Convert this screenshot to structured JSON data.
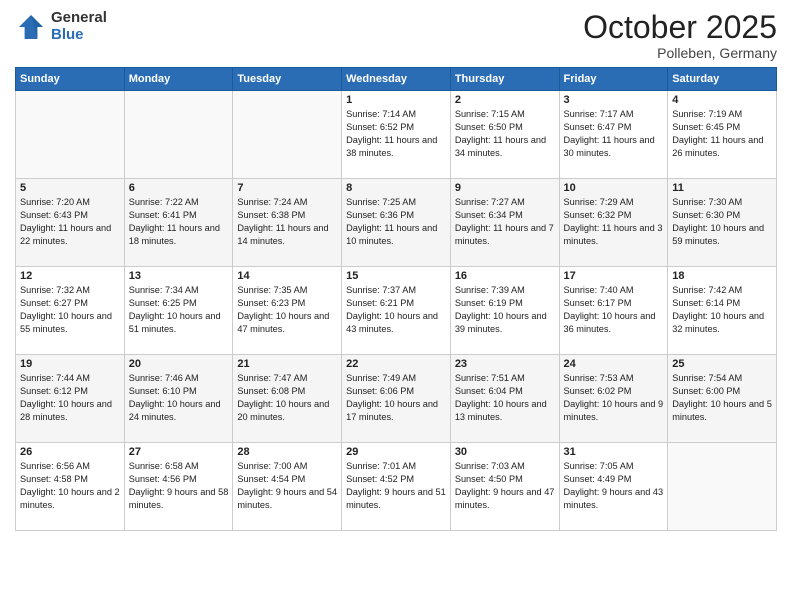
{
  "logo": {
    "general": "General",
    "blue": "Blue"
  },
  "title": "October 2025",
  "subtitle": "Polleben, Germany",
  "days_header": [
    "Sunday",
    "Monday",
    "Tuesday",
    "Wednesday",
    "Thursday",
    "Friday",
    "Saturday"
  ],
  "weeks": [
    [
      {
        "day": "",
        "sunrise": "",
        "sunset": "",
        "daylight": ""
      },
      {
        "day": "",
        "sunrise": "",
        "sunset": "",
        "daylight": ""
      },
      {
        "day": "",
        "sunrise": "",
        "sunset": "",
        "daylight": ""
      },
      {
        "day": "1",
        "sunrise": "Sunrise: 7:14 AM",
        "sunset": "Sunset: 6:52 PM",
        "daylight": "Daylight: 11 hours and 38 minutes."
      },
      {
        "day": "2",
        "sunrise": "Sunrise: 7:15 AM",
        "sunset": "Sunset: 6:50 PM",
        "daylight": "Daylight: 11 hours and 34 minutes."
      },
      {
        "day": "3",
        "sunrise": "Sunrise: 7:17 AM",
        "sunset": "Sunset: 6:47 PM",
        "daylight": "Daylight: 11 hours and 30 minutes."
      },
      {
        "day": "4",
        "sunrise": "Sunrise: 7:19 AM",
        "sunset": "Sunset: 6:45 PM",
        "daylight": "Daylight: 11 hours and 26 minutes."
      }
    ],
    [
      {
        "day": "5",
        "sunrise": "Sunrise: 7:20 AM",
        "sunset": "Sunset: 6:43 PM",
        "daylight": "Daylight: 11 hours and 22 minutes."
      },
      {
        "day": "6",
        "sunrise": "Sunrise: 7:22 AM",
        "sunset": "Sunset: 6:41 PM",
        "daylight": "Daylight: 11 hours and 18 minutes."
      },
      {
        "day": "7",
        "sunrise": "Sunrise: 7:24 AM",
        "sunset": "Sunset: 6:38 PM",
        "daylight": "Daylight: 11 hours and 14 minutes."
      },
      {
        "day": "8",
        "sunrise": "Sunrise: 7:25 AM",
        "sunset": "Sunset: 6:36 PM",
        "daylight": "Daylight: 11 hours and 10 minutes."
      },
      {
        "day": "9",
        "sunrise": "Sunrise: 7:27 AM",
        "sunset": "Sunset: 6:34 PM",
        "daylight": "Daylight: 11 hours and 7 minutes."
      },
      {
        "day": "10",
        "sunrise": "Sunrise: 7:29 AM",
        "sunset": "Sunset: 6:32 PM",
        "daylight": "Daylight: 11 hours and 3 minutes."
      },
      {
        "day": "11",
        "sunrise": "Sunrise: 7:30 AM",
        "sunset": "Sunset: 6:30 PM",
        "daylight": "Daylight: 10 hours and 59 minutes."
      }
    ],
    [
      {
        "day": "12",
        "sunrise": "Sunrise: 7:32 AM",
        "sunset": "Sunset: 6:27 PM",
        "daylight": "Daylight: 10 hours and 55 minutes."
      },
      {
        "day": "13",
        "sunrise": "Sunrise: 7:34 AM",
        "sunset": "Sunset: 6:25 PM",
        "daylight": "Daylight: 10 hours and 51 minutes."
      },
      {
        "day": "14",
        "sunrise": "Sunrise: 7:35 AM",
        "sunset": "Sunset: 6:23 PM",
        "daylight": "Daylight: 10 hours and 47 minutes."
      },
      {
        "day": "15",
        "sunrise": "Sunrise: 7:37 AM",
        "sunset": "Sunset: 6:21 PM",
        "daylight": "Daylight: 10 hours and 43 minutes."
      },
      {
        "day": "16",
        "sunrise": "Sunrise: 7:39 AM",
        "sunset": "Sunset: 6:19 PM",
        "daylight": "Daylight: 10 hours and 39 minutes."
      },
      {
        "day": "17",
        "sunrise": "Sunrise: 7:40 AM",
        "sunset": "Sunset: 6:17 PM",
        "daylight": "Daylight: 10 hours and 36 minutes."
      },
      {
        "day": "18",
        "sunrise": "Sunrise: 7:42 AM",
        "sunset": "Sunset: 6:14 PM",
        "daylight": "Daylight: 10 hours and 32 minutes."
      }
    ],
    [
      {
        "day": "19",
        "sunrise": "Sunrise: 7:44 AM",
        "sunset": "Sunset: 6:12 PM",
        "daylight": "Daylight: 10 hours and 28 minutes."
      },
      {
        "day": "20",
        "sunrise": "Sunrise: 7:46 AM",
        "sunset": "Sunset: 6:10 PM",
        "daylight": "Daylight: 10 hours and 24 minutes."
      },
      {
        "day": "21",
        "sunrise": "Sunrise: 7:47 AM",
        "sunset": "Sunset: 6:08 PM",
        "daylight": "Daylight: 10 hours and 20 minutes."
      },
      {
        "day": "22",
        "sunrise": "Sunrise: 7:49 AM",
        "sunset": "Sunset: 6:06 PM",
        "daylight": "Daylight: 10 hours and 17 minutes."
      },
      {
        "day": "23",
        "sunrise": "Sunrise: 7:51 AM",
        "sunset": "Sunset: 6:04 PM",
        "daylight": "Daylight: 10 hours and 13 minutes."
      },
      {
        "day": "24",
        "sunrise": "Sunrise: 7:53 AM",
        "sunset": "Sunset: 6:02 PM",
        "daylight": "Daylight: 10 hours and 9 minutes."
      },
      {
        "day": "25",
        "sunrise": "Sunrise: 7:54 AM",
        "sunset": "Sunset: 6:00 PM",
        "daylight": "Daylight: 10 hours and 5 minutes."
      }
    ],
    [
      {
        "day": "26",
        "sunrise": "Sunrise: 6:56 AM",
        "sunset": "Sunset: 4:58 PM",
        "daylight": "Daylight: 10 hours and 2 minutes."
      },
      {
        "day": "27",
        "sunrise": "Sunrise: 6:58 AM",
        "sunset": "Sunset: 4:56 PM",
        "daylight": "Daylight: 9 hours and 58 minutes."
      },
      {
        "day": "28",
        "sunrise": "Sunrise: 7:00 AM",
        "sunset": "Sunset: 4:54 PM",
        "daylight": "Daylight: 9 hours and 54 minutes."
      },
      {
        "day": "29",
        "sunrise": "Sunrise: 7:01 AM",
        "sunset": "Sunset: 4:52 PM",
        "daylight": "Daylight: 9 hours and 51 minutes."
      },
      {
        "day": "30",
        "sunrise": "Sunrise: 7:03 AM",
        "sunset": "Sunset: 4:50 PM",
        "daylight": "Daylight: 9 hours and 47 minutes."
      },
      {
        "day": "31",
        "sunrise": "Sunrise: 7:05 AM",
        "sunset": "Sunset: 4:49 PM",
        "daylight": "Daylight: 9 hours and 43 minutes."
      },
      {
        "day": "",
        "sunrise": "",
        "sunset": "",
        "daylight": ""
      }
    ]
  ]
}
